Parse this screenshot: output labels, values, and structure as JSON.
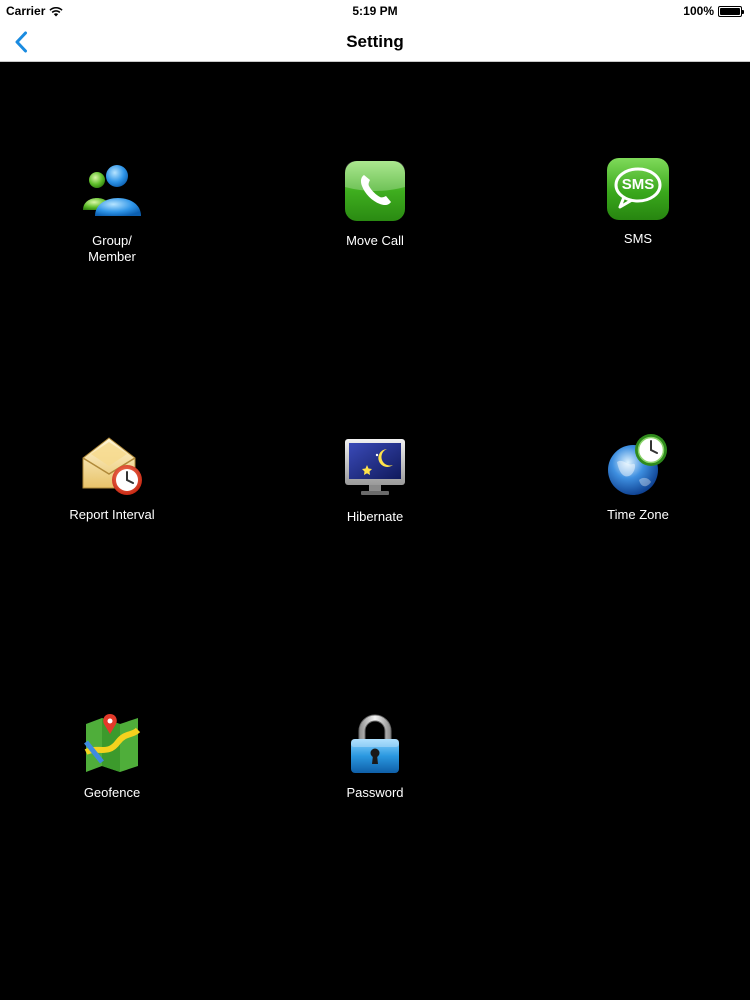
{
  "status_bar": {
    "carrier": "Carrier",
    "time": "5:19 PM",
    "battery": "100%",
    "wifi_icon": "wifi-icon",
    "battery_icon": "battery-icon"
  },
  "nav": {
    "title": "Setting",
    "back_icon": "chevron-left-icon"
  },
  "tiles": [
    {
      "label": "Group/\nMember",
      "icon": "group-member-icon"
    },
    {
      "label": "Move Call",
      "icon": "phone-icon"
    },
    {
      "label": "SMS",
      "icon": "sms-icon"
    },
    {
      "label": "Report Interval",
      "icon": "mail-clock-icon"
    },
    {
      "label": "Hibernate",
      "icon": "monitor-moon-icon"
    },
    {
      "label": "Time Zone",
      "icon": "globe-clock-icon"
    },
    {
      "label": "Geofence",
      "icon": "map-pin-icon"
    },
    {
      "label": "Password",
      "icon": "padlock-icon"
    }
  ],
  "icon_text": {
    "sms": "SMS"
  },
  "colors": {
    "accent": "#1a8be0",
    "background": "#000000",
    "bar": "#ffffff"
  }
}
